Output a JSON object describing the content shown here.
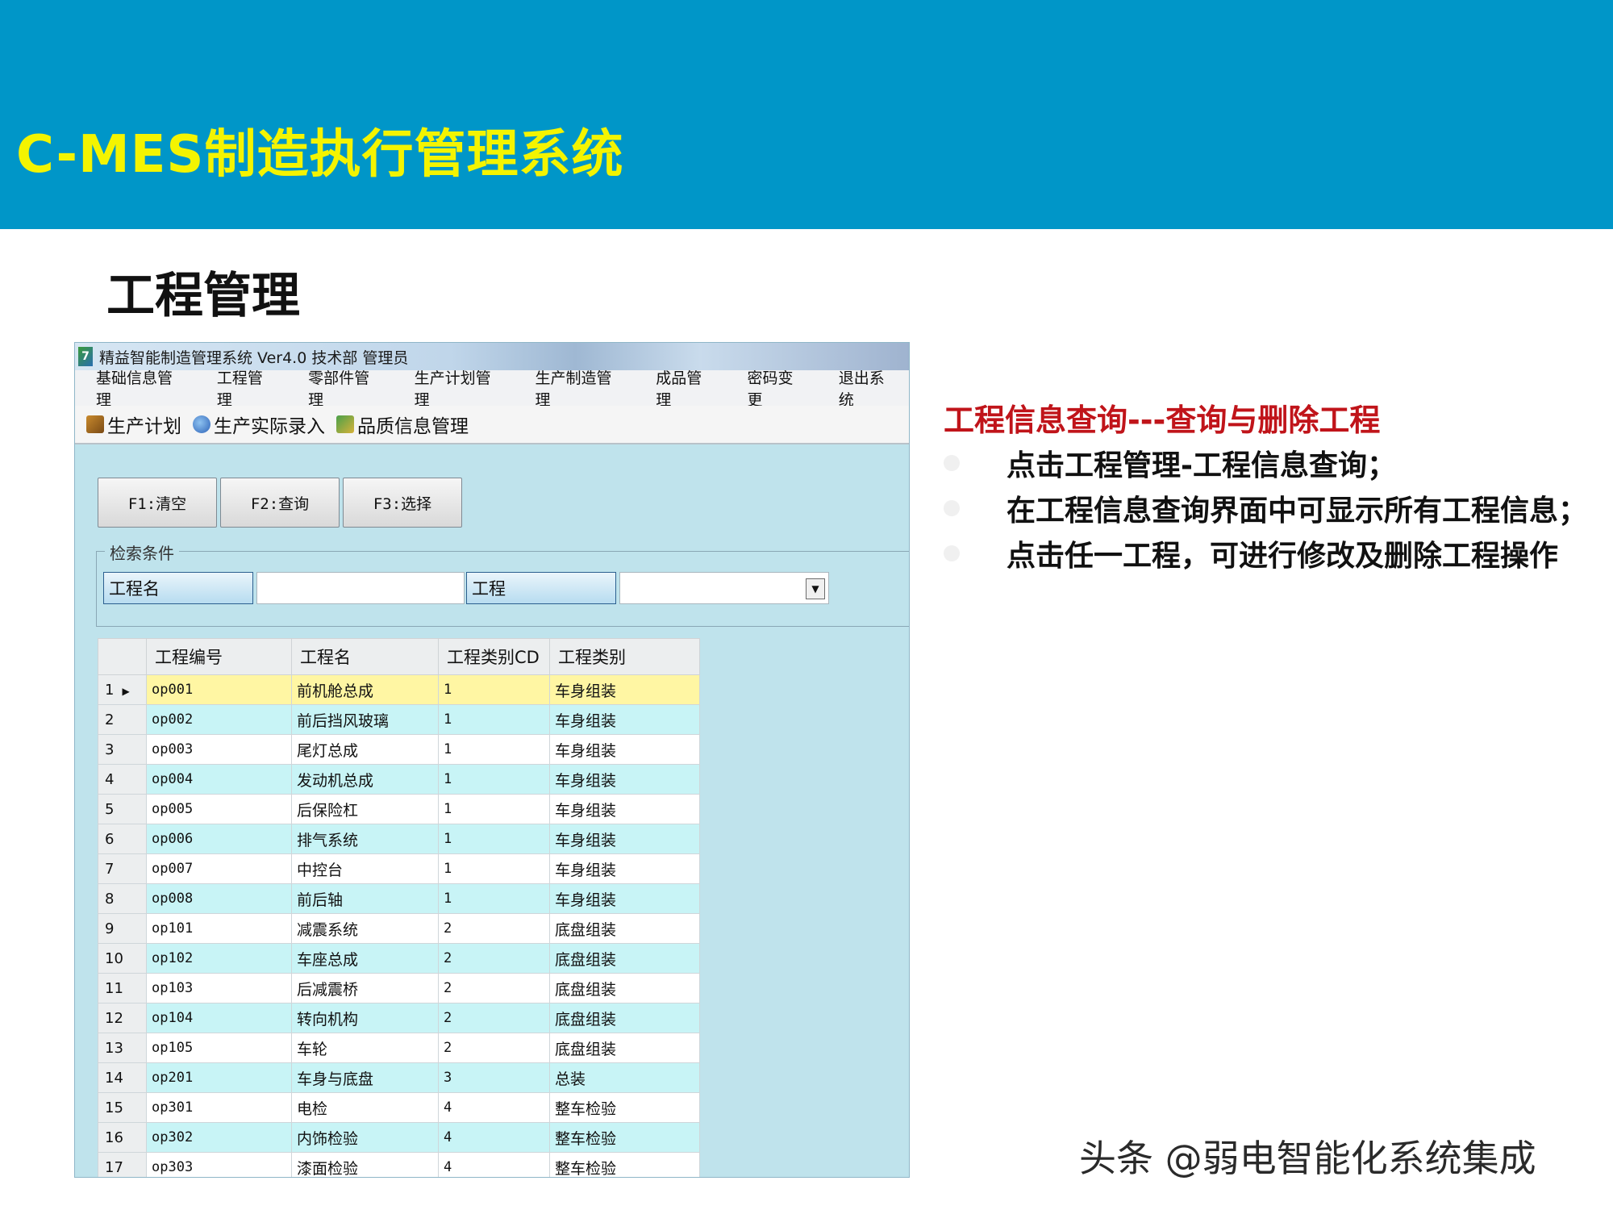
{
  "banner": {
    "title": "C-MES制造执行管理系统"
  },
  "page": {
    "heading": "工程管理"
  },
  "app": {
    "title": "精益智能制造管理系统 Ver4.0 技术部 管理员",
    "menu": [
      "基础信息管理",
      "工程管理",
      "零部件管理",
      "生产计划管理",
      "生产制造管理",
      "成品管理",
      "密码变更",
      "退出系统"
    ],
    "toolbar": [
      {
        "label": "生产计划",
        "icon": "plan-icon"
      },
      {
        "label": "生产实际录入",
        "icon": "entry-icon"
      },
      {
        "label": "品质信息管理",
        "icon": "quality-icon"
      }
    ],
    "buttons": {
      "clear": "F1:清空",
      "query": "F2:查询",
      "select": "F3:选择"
    },
    "search": {
      "legend": "检索条件",
      "name_label": "工程名",
      "name_value": "",
      "type_label": "工程",
      "type_value": ""
    },
    "grid": {
      "columns": [
        "工程编号",
        "工程名",
        "工程类别CD",
        "工程类别"
      ],
      "selected_row": 1,
      "rows": [
        [
          "1",
          "op001",
          "前机舱总成",
          "1",
          "车身组装"
        ],
        [
          "2",
          "op002",
          "前后挡风玻璃",
          "1",
          "车身组装"
        ],
        [
          "3",
          "op003",
          "尾灯总成",
          "1",
          "车身组装"
        ],
        [
          "4",
          "op004",
          "发动机总成",
          "1",
          "车身组装"
        ],
        [
          "5",
          "op005",
          "后保险杠",
          "1",
          "车身组装"
        ],
        [
          "6",
          "op006",
          "排气系统",
          "1",
          "车身组装"
        ],
        [
          "7",
          "op007",
          "中控台",
          "1",
          "车身组装"
        ],
        [
          "8",
          "op008",
          "前后轴",
          "1",
          "车身组装"
        ],
        [
          "9",
          "op101",
          "减震系统",
          "2",
          "底盘组装"
        ],
        [
          "10",
          "op102",
          "车座总成",
          "2",
          "底盘组装"
        ],
        [
          "11",
          "op103",
          "后减震桥",
          "2",
          "底盘组装"
        ],
        [
          "12",
          "op104",
          "转向机构",
          "2",
          "底盘组装"
        ],
        [
          "13",
          "op105",
          "车轮",
          "2",
          "底盘组装"
        ],
        [
          "14",
          "op201",
          "车身与底盘",
          "3",
          "总装"
        ],
        [
          "15",
          "op301",
          "电检",
          "4",
          "整车检验"
        ],
        [
          "16",
          "op302",
          "内饰检验",
          "4",
          "整车检验"
        ],
        [
          "17",
          "op303",
          "漆面检验",
          "4",
          "整车检验"
        ]
      ]
    }
  },
  "panel": {
    "heading": "工程信息查询---查询与删除工程",
    "bullets": [
      "点击工程管理-工程信息查询；",
      "在工程信息查询界面中可显示所有工程信息；",
      "点击任一工程，可进行修改及删除工程操作"
    ]
  },
  "watermark": "头条 @弱电智能化系统集成",
  "colors": {
    "banner": "#0096c8",
    "banner_title": "#f4f400",
    "panel_heading": "#c0141a",
    "row_alt": "#c8f4f6",
    "row_selected": "#fff6a3"
  }
}
